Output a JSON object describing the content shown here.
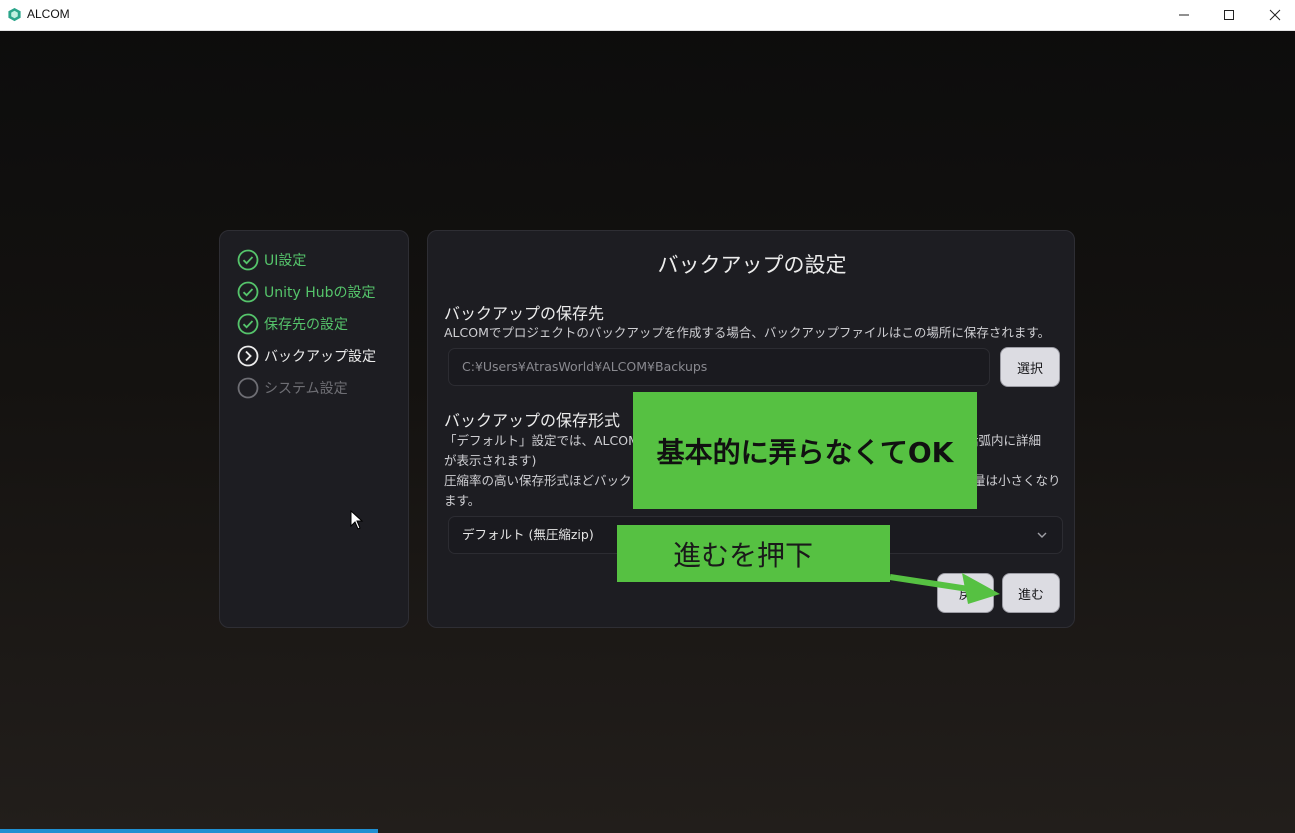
{
  "window": {
    "title": "ALCOM",
    "minimize_icon": "minimize-icon",
    "maximize_icon": "maximize-icon",
    "close_icon": "close-icon"
  },
  "steps": [
    {
      "label": "UI設定",
      "state": "done"
    },
    {
      "label": "Unity Hubの設定",
      "state": "done"
    },
    {
      "label": "保存先の設定",
      "state": "done"
    },
    {
      "label": "バックアップ設定",
      "state": "current"
    },
    {
      "label": "システム設定",
      "state": "pending"
    }
  ],
  "main": {
    "title": "バックアップの設定",
    "location": {
      "title": "バックアップの保存先",
      "description": "ALCOMでプロジェクトのバックアップを作成する場合、バックアップファイルはこの場所に保存されます。",
      "path": "C:¥Users¥AtrasWorld¥ALCOM¥Backups",
      "select_label": "選択"
    },
    "format": {
      "title": "バックアップの保存形式",
      "description_line1_start": "「デフォルト」設定では、ALCOM開",
      "description_line1_end": "括弧内に詳細",
      "description_line2": "が表示されます)",
      "description_line3_start": "圧縮率の高い保存形式ほどバック",
      "description_line3_end": "量は小さくなり",
      "description_line4": "ます。",
      "selected": "デフォルト (無圧縮zip)"
    },
    "back_label": "戻",
    "next_label": "進む"
  },
  "annotations": {
    "note1": "基本的に弄らなくてOK",
    "note2": "進むを押下"
  },
  "colors": {
    "accent_green": "#55c46b",
    "annotation_green": "#56c142"
  }
}
